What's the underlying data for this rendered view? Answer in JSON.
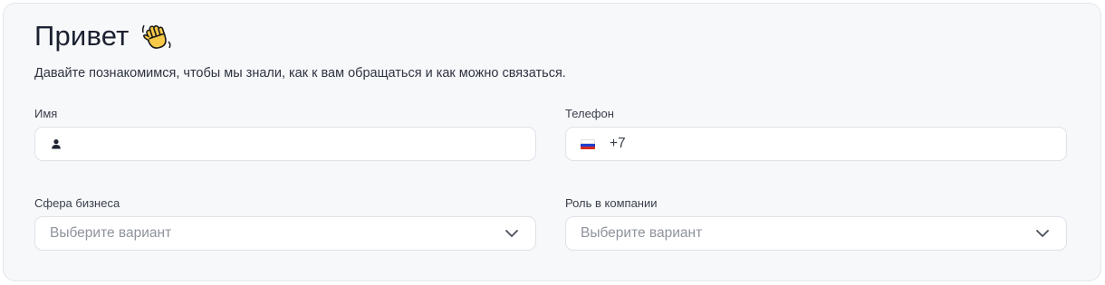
{
  "header": {
    "title": "Привет",
    "emoji_icon": "waving-hand-icon",
    "subtitle": "Давайте познакомимся, чтобы мы знали, как к вам обращаться и как можно связаться."
  },
  "form": {
    "name": {
      "label": "Имя",
      "value": "",
      "icon": "user-icon"
    },
    "phone": {
      "label": "Телефон",
      "country_flag": "ru-flag-icon",
      "prefix": "+7",
      "value": ""
    },
    "business": {
      "label": "Сфера бизнеса",
      "placeholder": "Выберите вариант",
      "icon": "chevron-down-icon"
    },
    "role": {
      "label": "Роль в компании",
      "placeholder": "Выберите вариант",
      "icon": "chevron-down-icon"
    }
  },
  "colors": {
    "card_bg": "#f7f8fa",
    "border": "#dfe2e8",
    "placeholder": "#8e939c",
    "flag_white": "#ffffff",
    "flag_blue": "#1c3fd1",
    "flag_red": "#d52b1e"
  }
}
